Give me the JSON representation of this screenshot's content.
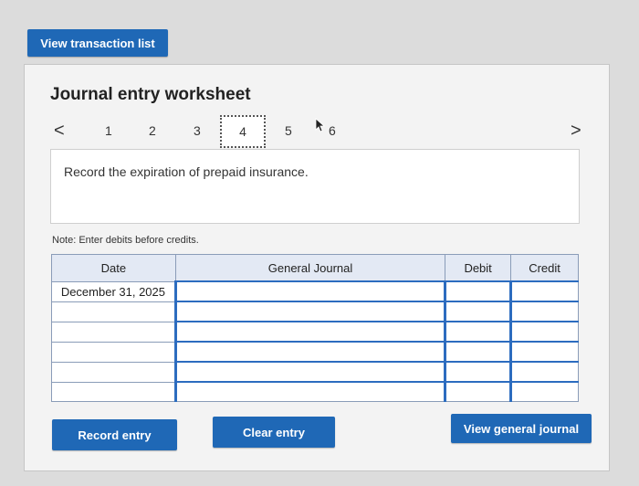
{
  "top_button": "View transaction list",
  "worksheet": {
    "title": "Journal entry worksheet",
    "nav": {
      "prev": "<",
      "next": ">",
      "pages": [
        "1",
        "2",
        "3",
        "4",
        "5",
        "6"
      ],
      "current": "4"
    },
    "prompt": "Record the expiration of prepaid insurance.",
    "note": "Note: Enter debits before credits.",
    "table": {
      "headers": [
        "Date",
        "General Journal",
        "Debit",
        "Credit"
      ],
      "rows": [
        [
          "December 31, 2025",
          "",
          "",
          ""
        ],
        [
          "",
          "",
          "",
          ""
        ],
        [
          "",
          "",
          "",
          ""
        ],
        [
          "",
          "",
          "",
          ""
        ],
        [
          "",
          "",
          "",
          ""
        ],
        [
          "",
          "",
          "",
          ""
        ]
      ]
    },
    "buttons": {
      "record": "Record entry",
      "clear": "Clear entry",
      "view_journal": "View general journal"
    }
  },
  "colors": {
    "button_blue": "#1f68b6",
    "header_fill": "#e3e9f4",
    "input_accent": "#2c6cbf"
  }
}
